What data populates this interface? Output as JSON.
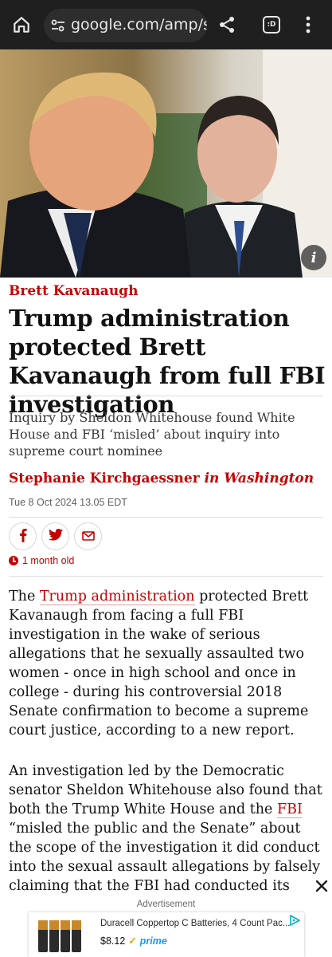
{
  "browser": {
    "url": "google.com/amp/s/ar",
    "tabs_label": ":D",
    "colors": {
      "bar": "#1f1f1f",
      "omnibox": "#2d2d2d"
    }
  },
  "hero": {
    "alt_icon": "info-icon",
    "info_label": "i"
  },
  "article": {
    "section": "Brett Kavanaugh",
    "headline": "Trump administration protected Brett Kavanaugh from full FBI investigation",
    "standfirst": "Inquiry by Sheldon Whitehouse found White House and FBI ‘misled’ about inquiry into supreme court nominee",
    "author": "Stephanie Kirchgaessner",
    "location": "in Washington",
    "date": "Tue 8 Oct 2024 13.05 EDT",
    "age": "1 month old",
    "share": [
      "facebook-icon",
      "twitter-icon",
      "email-icon"
    ],
    "p1": {
      "pre": "The ",
      "link": "Trump administration",
      "post": " protected Brett Kavanaugh from facing a full FBI investigation in the wake of serious allegations that he sexually assaulted two women - once in high school and once in college - during his controversial 2018 Senate confirmation to become a supreme court justice, according to a new report."
    },
    "p2": {
      "pre": "An investigation led by the Democratic senator Sheldon Whitehouse also found that both the Trump White House and the ",
      "link": "FBI",
      "post": " “misled the public and the Senate” about the scope of the investigation it did conduct into the sexual assault allegations by falsely claiming that the FBI had conducted its"
    },
    "accent": "#c70000"
  },
  "ad": {
    "label": "Advertisement",
    "title": "Duracell Coppertop C Batteries, 4 Count Pac...",
    "price": "$8.12",
    "prime_check": "✓",
    "prime": "prime"
  }
}
